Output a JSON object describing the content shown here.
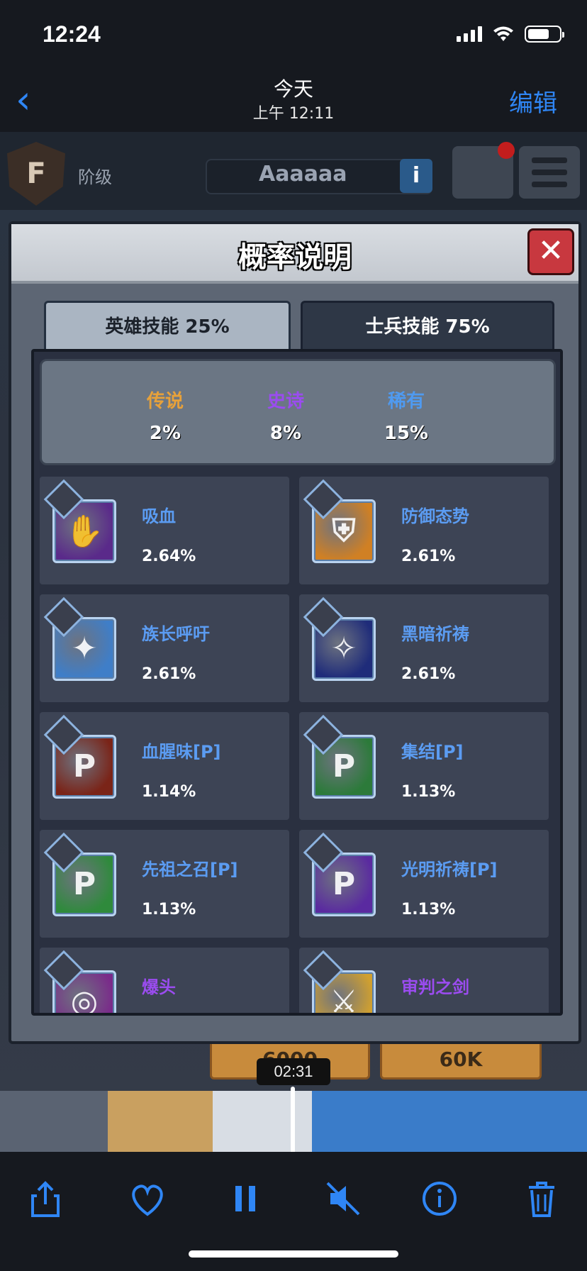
{
  "status_bar": {
    "time": "12:24"
  },
  "nav": {
    "back": "‹",
    "title": "今天",
    "subtitle": "上午 12:11",
    "edit": "编辑"
  },
  "game": {
    "rank_letter": "F",
    "rank_label": "阶级",
    "player_name": "Aaaaaa",
    "info_label": "i",
    "coin_left": "6000",
    "coin_right": "60K"
  },
  "video": {
    "elapsed": "02:31"
  },
  "dialog": {
    "title": "概率说明",
    "close": "✕",
    "tabs": [
      {
        "label": "英雄技能 25%",
        "active": true
      },
      {
        "label": "士兵技能 75%",
        "active": false
      }
    ],
    "rarities": [
      {
        "name": "传说",
        "value": "2%",
        "color": "#e7a13a"
      },
      {
        "name": "史诗",
        "value": "8%",
        "color": "#9b4cf0"
      },
      {
        "name": "稀有",
        "value": "15%",
        "color": "#4f9af0"
      }
    ],
    "skills": [
      {
        "name": "吸血",
        "pct": "2.64%",
        "icon": "vampire-hand-icon",
        "bg": "#5a2a8a",
        "glyph": "✋",
        "name_color": "#5b9cf2"
      },
      {
        "name": "防御态势",
        "pct": "2.61%",
        "icon": "defense-shield-icon",
        "bg": "#d08024",
        "glyph": "⛨",
        "name_color": "#5b9cf2"
      },
      {
        "name": "族长呼吁",
        "pct": "2.61%",
        "icon": "chief-call-icon",
        "bg": "#3f7ec8",
        "glyph": "✦",
        "name_color": "#5b9cf2"
      },
      {
        "name": "黑暗祈祷",
        "pct": "2.61%",
        "icon": "dark-prayer-flame-icon",
        "bg": "#1f2c7a",
        "glyph": "✧",
        "name_color": "#5b9cf2"
      },
      {
        "name": "血腥味[P]",
        "pct": "1.14%",
        "icon": "blood-scent-passive-icon",
        "bg": "#7a2418",
        "glyph": "P",
        "name_color": "#5b9cf2"
      },
      {
        "name": "集结[P]",
        "pct": "1.13%",
        "icon": "rally-passive-icon",
        "bg": "#2c7a3a",
        "glyph": "P",
        "name_color": "#5b9cf2"
      },
      {
        "name": "先祖之召[P]",
        "pct": "1.13%",
        "icon": "ancestor-call-passive-icon",
        "bg": "#2f8a3c",
        "glyph": "P",
        "name_color": "#5b9cf2"
      },
      {
        "name": "光明祈祷[P]",
        "pct": "1.13%",
        "icon": "light-prayer-passive-icon",
        "bg": "#5a2aa0",
        "glyph": "P",
        "name_color": "#5b9cf2"
      },
      {
        "name": "爆头",
        "pct": "",
        "icon": "headshot-icon",
        "bg": "#7a2a8a",
        "glyph": "◎",
        "name_color": "#9b4cf0"
      },
      {
        "name": "审判之剑",
        "pct": "",
        "icon": "judgement-sword-icon",
        "bg": "#d0a030",
        "glyph": "⚔",
        "name_color": "#9b4cf0"
      }
    ]
  },
  "toolbar": {
    "share": "share-icon",
    "favorite": "heart-icon",
    "pause": "pause-icon",
    "mute": "speaker-muted-icon",
    "info": "info-icon",
    "delete": "trash-icon"
  }
}
